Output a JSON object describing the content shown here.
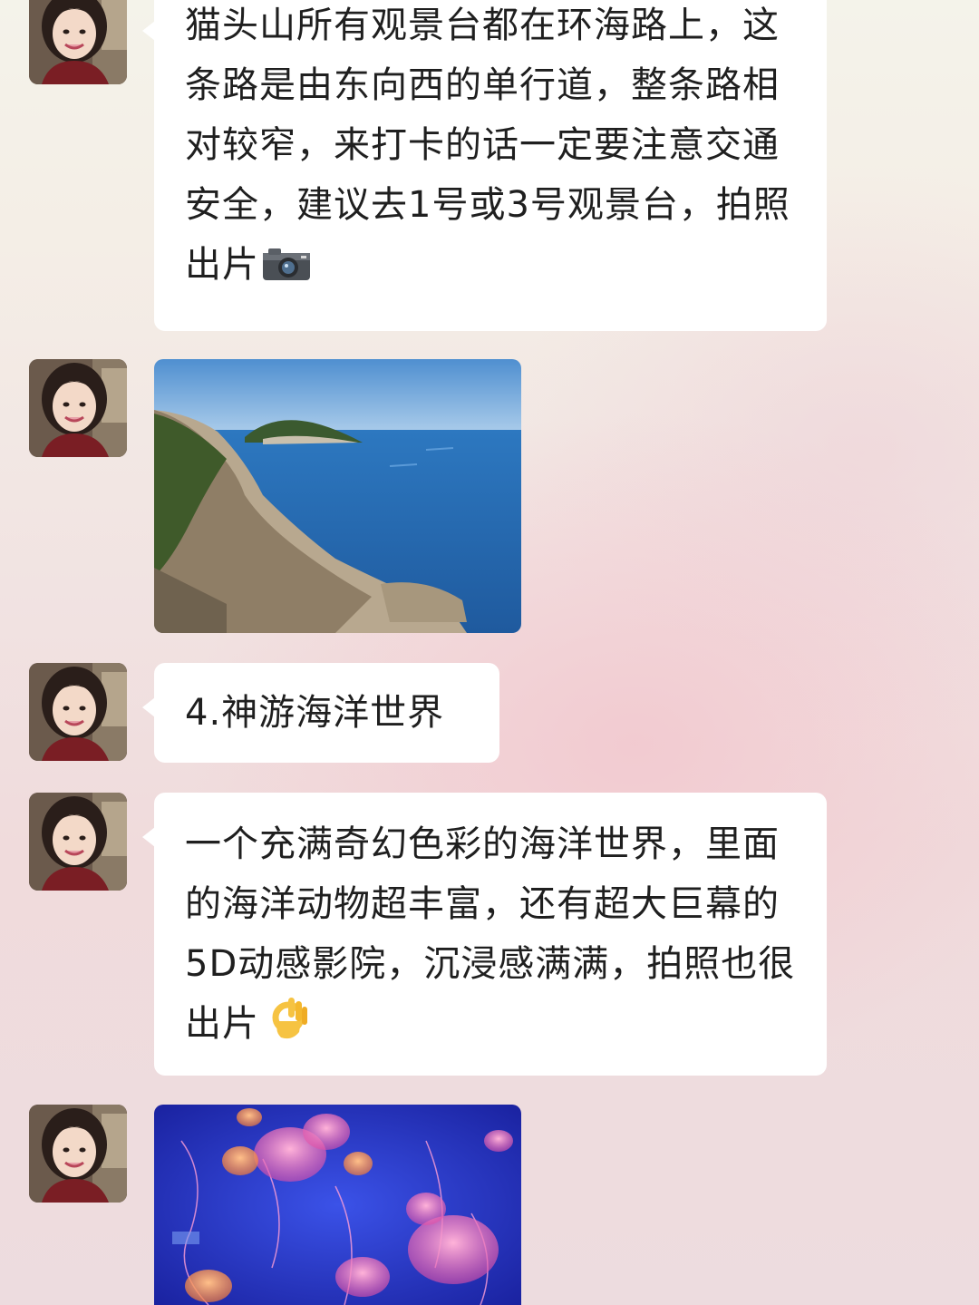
{
  "messages": [
    {
      "type": "text",
      "text": "猫头山所有观景台都在环海路上，这条路是由东向西的单行道，整条路相对较窄，来打卡的话一定要注意交通安全，建议去1号或3号观景台，拍照出片",
      "emoji": "camera-emoji"
    },
    {
      "type": "image",
      "image": "coastal-cliff-sea-photo"
    },
    {
      "type": "text",
      "text": "4.神游海洋世界"
    },
    {
      "type": "text",
      "text": "一个充满奇幻色彩的海洋世界，里面的海洋动物超丰富，还有超大巨幕的5D动感影院，沉浸感满满，拍照也很出片",
      "emoji": "ok-hand-emoji"
    },
    {
      "type": "image",
      "image": "jellyfish-aquarium-photo"
    }
  ],
  "colors": {
    "bubble": "#ffffff",
    "text": "#1f1f1f",
    "sea": "#2f74b8",
    "aquarium": "#2a3fd0"
  }
}
